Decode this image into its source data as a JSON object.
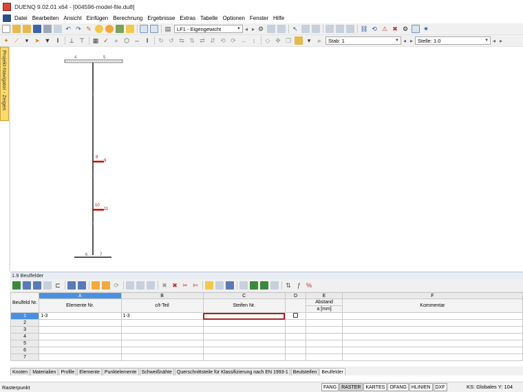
{
  "window": {
    "title": "DUENQ 9.02.01 x64 - [004596-model-file.du8]"
  },
  "menu": {
    "items": [
      "Datei",
      "Bearbeiten",
      "Ansicht",
      "Einfügen",
      "Berechnung",
      "Ergebnisse",
      "Extras",
      "Tabelle",
      "Optionen",
      "Fenster",
      "Hilfe"
    ]
  },
  "toolbar": {
    "loadcase_combo": "LF1 - Eigengewicht",
    "member_combo": "Stab: 1",
    "position_combo": "Stelle: 1.0"
  },
  "navigator": {
    "label": "Projekt-Navigator - Zeigen"
  },
  "model": {
    "support_labels": [
      "4",
      "5",
      "6",
      "7"
    ],
    "node_labels": [
      "1",
      "2",
      "3"
    ],
    "stiffener_labels": [
      "8",
      "9",
      "10",
      "11"
    ]
  },
  "panel": {
    "title": "1.9 Beulfelder"
  },
  "table": {
    "columns": [
      "A",
      "B",
      "C",
      "D",
      "E",
      "F"
    ],
    "header_rownum": "Beulfeld Nr.",
    "headers": {
      "A": "Elemente Nr.",
      "B": "c/t-Teil",
      "C": "Steifen Nr.",
      "D": "",
      "E_top": "Abstand",
      "E": "a [mm]",
      "F": "Kommentar"
    },
    "rows": [
      {
        "nr": "1",
        "A": "1-3",
        "B": "1-3",
        "C": "",
        "D_checkbox": true,
        "E": "",
        "F": ""
      },
      {
        "nr": "2",
        "A": "",
        "B": "",
        "C": "",
        "D_checkbox": false,
        "E": "",
        "F": ""
      },
      {
        "nr": "3",
        "A": "",
        "B": "",
        "C": "",
        "D_checkbox": false,
        "E": "",
        "F": ""
      },
      {
        "nr": "4",
        "A": "",
        "B": "",
        "C": "",
        "D_checkbox": false,
        "E": "",
        "F": ""
      },
      {
        "nr": "5",
        "A": "",
        "B": "",
        "C": "",
        "D_checkbox": false,
        "E": "",
        "F": ""
      },
      {
        "nr": "6",
        "A": "",
        "B": "",
        "C": "",
        "D_checkbox": false,
        "E": "",
        "F": ""
      },
      {
        "nr": "7",
        "A": "",
        "B": "",
        "C": "",
        "D_checkbox": false,
        "E": "",
        "F": ""
      }
    ]
  },
  "sheet_tabs": [
    "Knoten",
    "Materialien",
    "Profile",
    "Elemente",
    "Punktelemente",
    "Schweißnähte",
    "Querschnittsteile für Klassifizierung nach EN 1993-1",
    "Beulsteifen",
    "Beulfelder"
  ],
  "sheet_tabs_active": "Beulfelder",
  "status": {
    "text": "Rasterpunkt",
    "toggles": [
      "FANG",
      "RASTER",
      "KARTES",
      "OFANG",
      "HLINIEN",
      "DXF"
    ],
    "toggles_on": [
      "RASTER"
    ],
    "coords": "KS: Globales  Y: 104"
  },
  "colors": {
    "selection": "#4a90e2",
    "highlight_cell_border": "#b02020",
    "stiffener": "#cc0000",
    "navigator_tab": "#fbd96b"
  }
}
